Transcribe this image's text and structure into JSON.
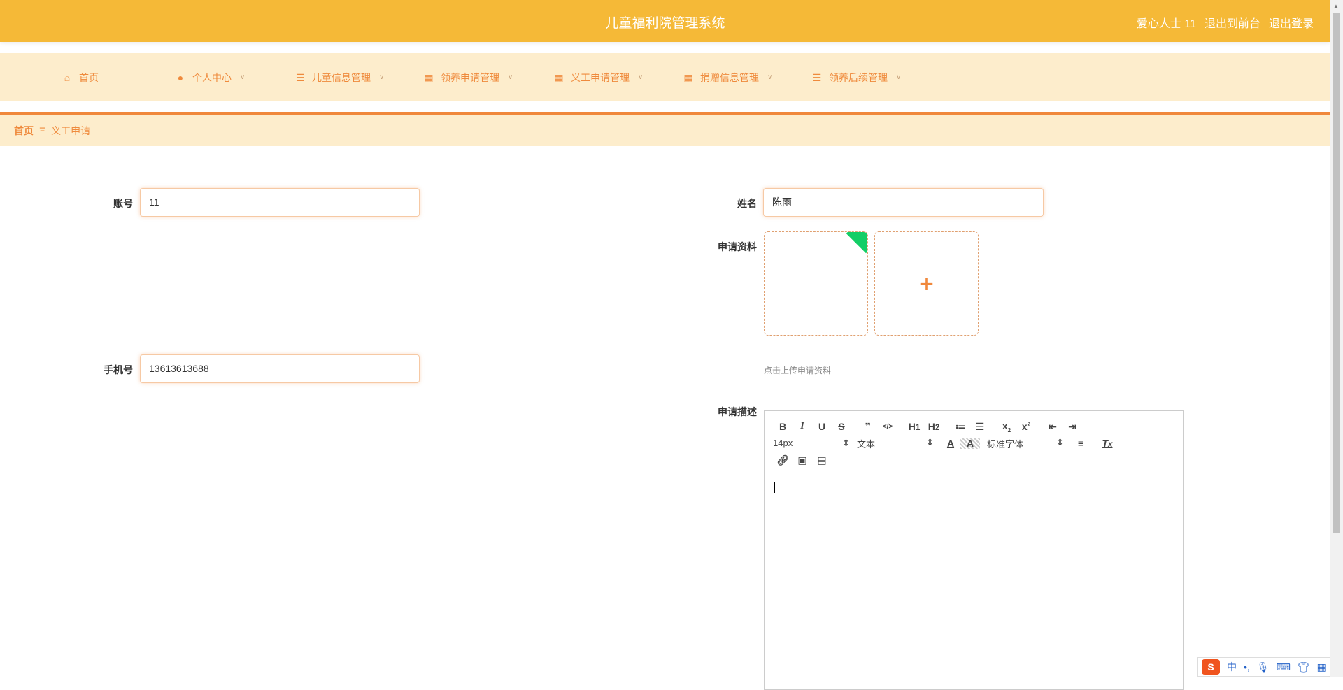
{
  "header": {
    "title": "儿童福利院管理系统",
    "user": "爱心人士 11",
    "to_front": "退出到前台",
    "logout": "退出登录"
  },
  "nav": [
    {
      "label": "首页",
      "icon": "home-icon"
    },
    {
      "label": "个人中心",
      "icon": "user-icon"
    },
    {
      "label": "儿童信息管理",
      "icon": "list-icon"
    },
    {
      "label": "领养申请管理",
      "icon": "grid-icon"
    },
    {
      "label": "义工申请管理",
      "icon": "grid-icon"
    },
    {
      "label": "捐赠信息管理",
      "icon": "grid-icon"
    },
    {
      "label": "领养后续管理",
      "icon": "list-icon"
    }
  ],
  "breadcrumb": {
    "home": "首页",
    "sep": "Ξ",
    "current": "义工申请"
  },
  "form": {
    "account_label": "账号",
    "account_value": "11",
    "name_label": "姓名",
    "name_value": "陈雨",
    "phone_label": "手机号",
    "phone_value": "13613613688",
    "material_label": "申请资料",
    "material_hint": "点击上传申请资料",
    "desc_label": "申请描述"
  },
  "editor": {
    "font_size": "14px",
    "block_type": "文本",
    "font_family": "标准字体"
  },
  "ime": {
    "lang": "中",
    "logo": "S"
  },
  "colors": {
    "header": "#f5b937",
    "accent": "#f0883c",
    "nav_bg": "#fdedcc"
  }
}
